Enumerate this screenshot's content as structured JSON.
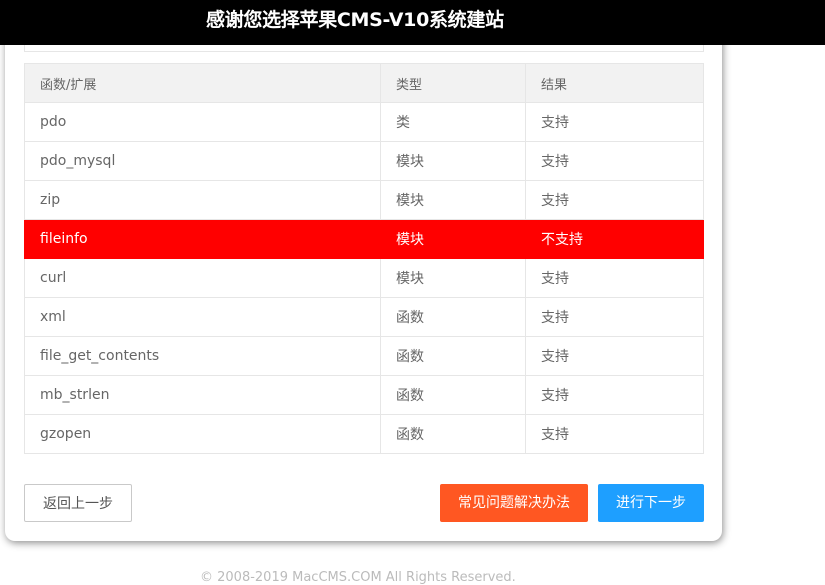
{
  "header": {
    "title": "感谢您选择苹果CMS-V10系统建站"
  },
  "table": {
    "columns": [
      "函数/扩展",
      "类型",
      "结果"
    ],
    "rows": [
      {
        "name": "pdo",
        "type": "类",
        "result": "支持"
      },
      {
        "name": "pdo_mysql",
        "type": "模块",
        "result": "支持"
      },
      {
        "name": "zip",
        "type": "模块",
        "result": "支持"
      },
      {
        "name": "fileinfo",
        "type": "模块",
        "result": "不支持"
      },
      {
        "name": "curl",
        "type": "模块",
        "result": "支持"
      },
      {
        "name": "xml",
        "type": "函数",
        "result": "支持"
      },
      {
        "name": "file_get_contents",
        "type": "函数",
        "result": "支持"
      },
      {
        "name": "mb_strlen",
        "type": "函数",
        "result": "支持"
      },
      {
        "name": "gzopen",
        "type": "函数",
        "result": "支持"
      }
    ]
  },
  "buttons": {
    "back": "返回上一步",
    "faq": "常见问题解决办法",
    "next": "进行下一步"
  },
  "footer": {
    "text": "© 2008-2019 MacCMS.COM All Rights Reserved."
  },
  "colors": {
    "error_row": "#ff0000",
    "faq_button": "#ff5722",
    "next_button": "#1e9fff",
    "topbar": "#000000"
  }
}
